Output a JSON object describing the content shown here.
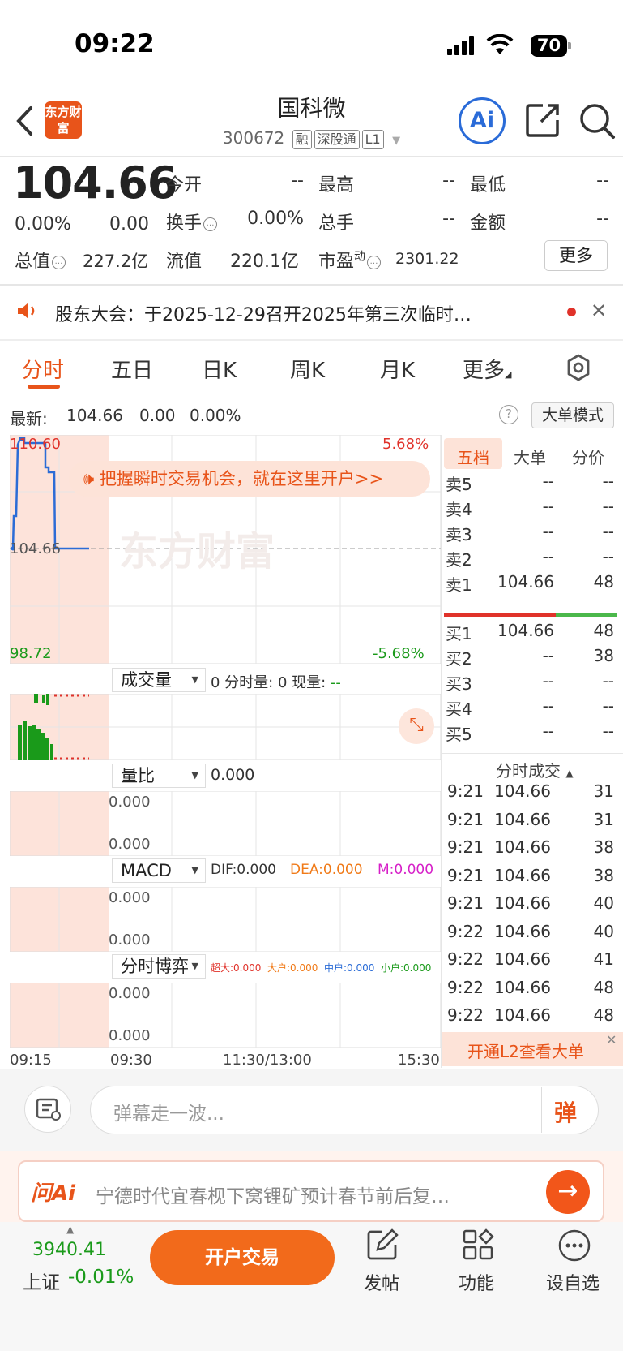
{
  "status_bar": {
    "time": "09:22",
    "battery": "70"
  },
  "header": {
    "back_icon": "chevron-left-icon",
    "logo_text": "东方财富",
    "stock_name": "国科微",
    "stock_code": "300672",
    "tags": [
      "融",
      "深股通",
      "L1"
    ],
    "ai_label": "Ai"
  },
  "quote": {
    "price": "104.66",
    "change_pct": "0.00%",
    "change": "0.00",
    "fields": [
      {
        "label": "今开",
        "value": "--"
      },
      {
        "label": "最高",
        "value": "--"
      },
      {
        "label": "最低",
        "value": "--"
      },
      {
        "label": "换手",
        "value": "0.00%"
      },
      {
        "label": "总手",
        "value": "--"
      },
      {
        "label": "金额",
        "value": "--"
      },
      {
        "label": "总值",
        "value": "227.2亿"
      },
      {
        "label": "流值",
        "value": "220.1亿"
      },
      {
        "label": "市盈",
        "value": "2301.22",
        "sup": "动"
      }
    ],
    "more_label": "更多"
  },
  "notice": {
    "text": "股东大会：于2025-12-29召开2025年第三次临时…"
  },
  "tabs": [
    "分时",
    "五日",
    "日K",
    "周K",
    "月K",
    "更多"
  ],
  "chart": {
    "latest_label": "最新:",
    "latest_price": "104.66",
    "latest_change": "0.00",
    "latest_pct": "0.00%",
    "big_order_mode": "大单模式",
    "price_high": "110.60",
    "price_mid": "104.66",
    "price_low": "98.72",
    "pct_high": "5.68%",
    "pct_low": "-5.68%",
    "banner": "把握瞬时交易机会，就在这里开户>>",
    "watermark": "东方财富",
    "volume_dd": "成交量",
    "volume_info_a": "0 分时量: 0 现量: ",
    "volume_info_b": "--",
    "ratio_dd": "量比",
    "ratio_value": "0.000",
    "ratio_top": "0.000",
    "ratio_bottom": "0.000",
    "macd_dd": "MACD",
    "dif": "DIF:0.000",
    "dea": "DEA:0.000",
    "m": "M:0.000",
    "macd_top": "0.000",
    "macd_bottom": "0.000",
    "game_dd": "分时博弈",
    "game_super": "超大:0.000",
    "game_large": "大户:0.000",
    "game_mid": "中户:0.000",
    "game_small": "小户:0.000",
    "game_top": "0.000",
    "game_bottom": "0.000",
    "time_axis": [
      "09:15",
      "09:30",
      "11:30/13:00",
      "15:30"
    ]
  },
  "order_book": {
    "tabs": [
      "五档",
      "大单",
      "分价"
    ],
    "sells": [
      {
        "label": "卖5",
        "price": "--",
        "vol": "--"
      },
      {
        "label": "卖4",
        "price": "--",
        "vol": "--"
      },
      {
        "label": "卖3",
        "price": "--",
        "vol": "--"
      },
      {
        "label": "卖2",
        "price": "--",
        "vol": "--"
      },
      {
        "label": "卖1",
        "price": "104.66",
        "vol": "48"
      }
    ],
    "buys": [
      {
        "label": "买1",
        "price": "104.66",
        "vol": "48"
      },
      {
        "label": "买2",
        "price": "--",
        "vol": "38"
      },
      {
        "label": "买3",
        "price": "--",
        "vol": "--"
      },
      {
        "label": "买4",
        "price": "--",
        "vol": "--"
      },
      {
        "label": "买5",
        "price": "--",
        "vol": "--"
      }
    ],
    "trades_title": "分时成交",
    "trades": [
      {
        "time": "9:21",
        "price": "104.66",
        "vol": "31"
      },
      {
        "time": "9:21",
        "price": "104.66",
        "vol": "31"
      },
      {
        "time": "9:21",
        "price": "104.66",
        "vol": "38"
      },
      {
        "time": "9:21",
        "price": "104.66",
        "vol": "38"
      },
      {
        "time": "9:21",
        "price": "104.66",
        "vol": "40"
      },
      {
        "time": "9:22",
        "price": "104.66",
        "vol": "40"
      },
      {
        "time": "9:22",
        "price": "104.66",
        "vol": "41"
      },
      {
        "time": "9:22",
        "price": "104.66",
        "vol": "48"
      },
      {
        "time": "9:22",
        "price": "104.66",
        "vol": "48"
      }
    ],
    "l2_promo": "开通L2查看大单"
  },
  "danmu": {
    "placeholder": "弹幕走一波...",
    "send": "弹"
  },
  "ai_bar": {
    "brand": "问Ai",
    "text": "宁德时代宜春枧下窝锂矿预计春节前后复…"
  },
  "bottom_nav": {
    "index_value": "3940.41",
    "index_name": "上证",
    "index_change": "-0.01%",
    "open_trade": "开户交易",
    "items": [
      "发帖",
      "功能",
      "设自选"
    ]
  },
  "colors": {
    "accent": "#e8541a",
    "up": "#e0322a",
    "down": "#1a9a1a",
    "line": "#2b6cd6"
  }
}
